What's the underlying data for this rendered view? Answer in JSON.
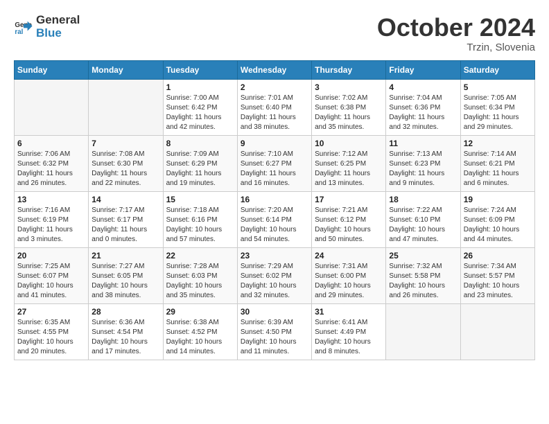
{
  "logo": {
    "general": "General",
    "blue": "Blue"
  },
  "title": "October 2024",
  "subtitle": "Trzin, Slovenia",
  "days_of_week": [
    "Sunday",
    "Monday",
    "Tuesday",
    "Wednesday",
    "Thursday",
    "Friday",
    "Saturday"
  ],
  "weeks": [
    [
      {
        "day": "",
        "info": ""
      },
      {
        "day": "",
        "info": ""
      },
      {
        "day": "1",
        "info": "Sunrise: 7:00 AM\nSunset: 6:42 PM\nDaylight: 11 hours and 42 minutes."
      },
      {
        "day": "2",
        "info": "Sunrise: 7:01 AM\nSunset: 6:40 PM\nDaylight: 11 hours and 38 minutes."
      },
      {
        "day": "3",
        "info": "Sunrise: 7:02 AM\nSunset: 6:38 PM\nDaylight: 11 hours and 35 minutes."
      },
      {
        "day": "4",
        "info": "Sunrise: 7:04 AM\nSunset: 6:36 PM\nDaylight: 11 hours and 32 minutes."
      },
      {
        "day": "5",
        "info": "Sunrise: 7:05 AM\nSunset: 6:34 PM\nDaylight: 11 hours and 29 minutes."
      }
    ],
    [
      {
        "day": "6",
        "info": "Sunrise: 7:06 AM\nSunset: 6:32 PM\nDaylight: 11 hours and 26 minutes."
      },
      {
        "day": "7",
        "info": "Sunrise: 7:08 AM\nSunset: 6:30 PM\nDaylight: 11 hours and 22 minutes."
      },
      {
        "day": "8",
        "info": "Sunrise: 7:09 AM\nSunset: 6:29 PM\nDaylight: 11 hours and 19 minutes."
      },
      {
        "day": "9",
        "info": "Sunrise: 7:10 AM\nSunset: 6:27 PM\nDaylight: 11 hours and 16 minutes."
      },
      {
        "day": "10",
        "info": "Sunrise: 7:12 AM\nSunset: 6:25 PM\nDaylight: 11 hours and 13 minutes."
      },
      {
        "day": "11",
        "info": "Sunrise: 7:13 AM\nSunset: 6:23 PM\nDaylight: 11 hours and 9 minutes."
      },
      {
        "day": "12",
        "info": "Sunrise: 7:14 AM\nSunset: 6:21 PM\nDaylight: 11 hours and 6 minutes."
      }
    ],
    [
      {
        "day": "13",
        "info": "Sunrise: 7:16 AM\nSunset: 6:19 PM\nDaylight: 11 hours and 3 minutes."
      },
      {
        "day": "14",
        "info": "Sunrise: 7:17 AM\nSunset: 6:17 PM\nDaylight: 11 hours and 0 minutes."
      },
      {
        "day": "15",
        "info": "Sunrise: 7:18 AM\nSunset: 6:16 PM\nDaylight: 10 hours and 57 minutes."
      },
      {
        "day": "16",
        "info": "Sunrise: 7:20 AM\nSunset: 6:14 PM\nDaylight: 10 hours and 54 minutes."
      },
      {
        "day": "17",
        "info": "Sunrise: 7:21 AM\nSunset: 6:12 PM\nDaylight: 10 hours and 50 minutes."
      },
      {
        "day": "18",
        "info": "Sunrise: 7:22 AM\nSunset: 6:10 PM\nDaylight: 10 hours and 47 minutes."
      },
      {
        "day": "19",
        "info": "Sunrise: 7:24 AM\nSunset: 6:09 PM\nDaylight: 10 hours and 44 minutes."
      }
    ],
    [
      {
        "day": "20",
        "info": "Sunrise: 7:25 AM\nSunset: 6:07 PM\nDaylight: 10 hours and 41 minutes."
      },
      {
        "day": "21",
        "info": "Sunrise: 7:27 AM\nSunset: 6:05 PM\nDaylight: 10 hours and 38 minutes."
      },
      {
        "day": "22",
        "info": "Sunrise: 7:28 AM\nSunset: 6:03 PM\nDaylight: 10 hours and 35 minutes."
      },
      {
        "day": "23",
        "info": "Sunrise: 7:29 AM\nSunset: 6:02 PM\nDaylight: 10 hours and 32 minutes."
      },
      {
        "day": "24",
        "info": "Sunrise: 7:31 AM\nSunset: 6:00 PM\nDaylight: 10 hours and 29 minutes."
      },
      {
        "day": "25",
        "info": "Sunrise: 7:32 AM\nSunset: 5:58 PM\nDaylight: 10 hours and 26 minutes."
      },
      {
        "day": "26",
        "info": "Sunrise: 7:34 AM\nSunset: 5:57 PM\nDaylight: 10 hours and 23 minutes."
      }
    ],
    [
      {
        "day": "27",
        "info": "Sunrise: 6:35 AM\nSunset: 4:55 PM\nDaylight: 10 hours and 20 minutes."
      },
      {
        "day": "28",
        "info": "Sunrise: 6:36 AM\nSunset: 4:54 PM\nDaylight: 10 hours and 17 minutes."
      },
      {
        "day": "29",
        "info": "Sunrise: 6:38 AM\nSunset: 4:52 PM\nDaylight: 10 hours and 14 minutes."
      },
      {
        "day": "30",
        "info": "Sunrise: 6:39 AM\nSunset: 4:50 PM\nDaylight: 10 hours and 11 minutes."
      },
      {
        "day": "31",
        "info": "Sunrise: 6:41 AM\nSunset: 4:49 PM\nDaylight: 10 hours and 8 minutes."
      },
      {
        "day": "",
        "info": ""
      },
      {
        "day": "",
        "info": ""
      }
    ]
  ]
}
